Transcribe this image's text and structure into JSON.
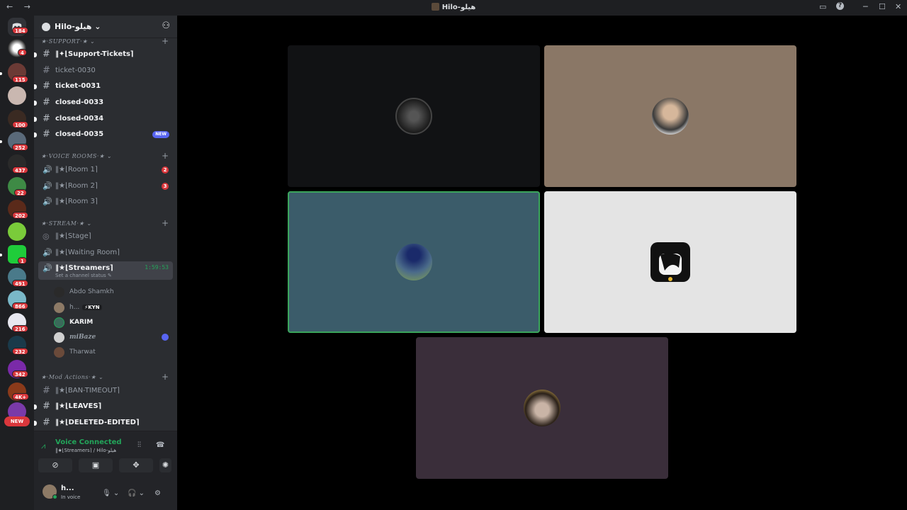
{
  "window": {
    "title": "Hilo-هيلو",
    "nav": "← →"
  },
  "server_rail": {
    "badges": [
      "184",
      "4",
      "115",
      "100",
      "252",
      "437",
      "22",
      "202",
      "1",
      "491",
      "866",
      "216",
      "232",
      "342",
      "4K+"
    ],
    "new_label": "NEW"
  },
  "guild": {
    "name": "Hilo-هيلو ⌄"
  },
  "categories": {
    "support": "★·SUPPORT·★ ⌄",
    "voice": "★·VOICE ROOMS·★ ⌄",
    "stream": "★·STREAM·★ ⌄",
    "mod": "★·Mod Actions·★ ⌄"
  },
  "channels": {
    "support_tickets": "‖✦⌊Support-Tickets⌉",
    "ticket_0030": "ticket-0030",
    "ticket_0031": "ticket-0031",
    "closed_0033": "closed-0033",
    "closed_0034": "closed-0034",
    "closed_0035": "closed-0035",
    "closed_0035_badge": "NEW",
    "room1": "‖★⌊Room 1⌉",
    "room1_badge": "2",
    "room2": "‖★⌊Room 2⌉",
    "room2_badge": "3",
    "room3": "‖★⌊Room 3⌉",
    "stage": "‖★⌊Stage⌉",
    "waiting": "‖★⌊Waiting Room⌉",
    "streamers": "‖★⌊Streamers⌉",
    "streamers_timer": "1:59:53",
    "streamers_status": "Set a channel status ✎",
    "ban_timeout": "‖★⌊BAN-TIMEOUT⌉",
    "leaves": "‖★⌊LEAVES⌉",
    "deleted_edited": "‖★⌊DELETED-EDITED⌉"
  },
  "voice_users": [
    {
      "name": "Abdo Shamkh"
    },
    {
      "name": "h...",
      "tag": "⚡KYN"
    },
    {
      "name": "KARIM"
    },
    {
      "name": "miBaze"
    },
    {
      "name": "Tharwat"
    }
  ],
  "voice_panel": {
    "title": "Voice Connected",
    "subtitle": "‖★⌊Streamers⌉ / Hilo-هيلو"
  },
  "user_panel": {
    "name": "h...",
    "status": "In voice"
  },
  "colors": {
    "online": "#23a55a",
    "accent": "#5865f2",
    "danger": "#da373c"
  }
}
